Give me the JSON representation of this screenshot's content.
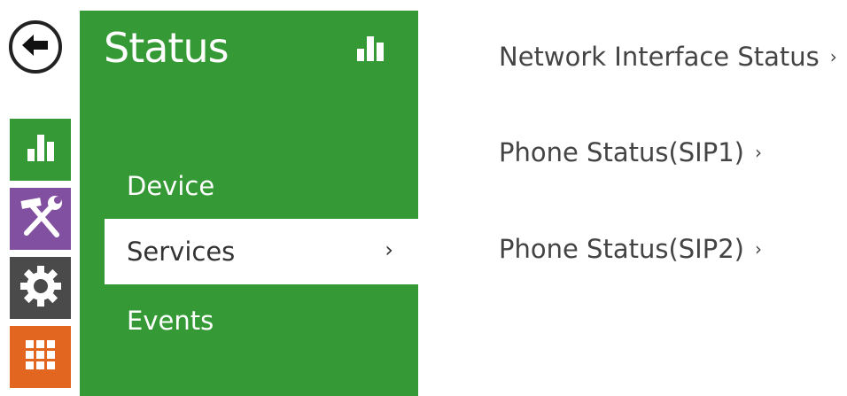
{
  "icons": {
    "back": "arrow-left-icon",
    "status": "bar-chart-icon",
    "services": "tools-icon",
    "settings": "gear-icon",
    "apps": "grid-icon",
    "chevron": "chevron-right-icon"
  },
  "colors": {
    "green": "#359a35",
    "purple": "#8250a0",
    "dark_gray": "#4a4a4a",
    "orange": "#e2661f"
  },
  "panel": {
    "title": "Status",
    "menu": [
      {
        "label": "Device"
      },
      {
        "label": "Services",
        "chevron": "›"
      },
      {
        "label": "Events"
      }
    ]
  },
  "main": {
    "links": [
      {
        "label": "Network Interface Status",
        "chevron": "›"
      },
      {
        "label": "Phone Status(SIP1)",
        "chevron": "›"
      },
      {
        "label": "Phone Status(SIP2)",
        "chevron": "›"
      }
    ]
  }
}
